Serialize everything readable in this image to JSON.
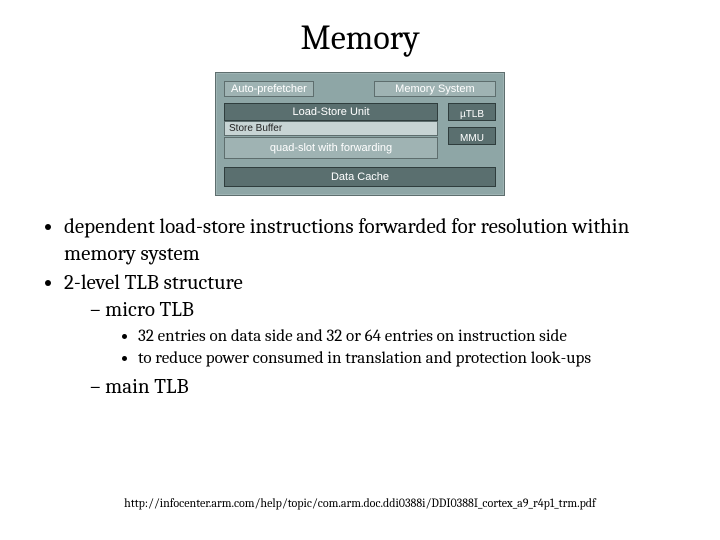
{
  "title": "Memory",
  "diagram": {
    "auto_prefetcher": "Auto-prefetcher",
    "memory_system": "Memory System",
    "load_store_unit": "Load-Store Unit",
    "store_buffer": "Store Buffer",
    "quad_slot": "quad-slot with forwarding",
    "utlb": "µTLB",
    "mmu": "MMU",
    "data_cache": "Data Cache"
  },
  "bullets": {
    "b1": "dependent load-store instructions forwarded for resolution within memory system",
    "b2": "2-level TLB structure",
    "b2a": "micro TLB",
    "b2a1": "32 entries on data side and 32 or 64 entries on instruction side",
    "b2a2": "to reduce power consumed in translation and protection look-ups",
    "b2b": "main TLB"
  },
  "footer": "http://infocenter.arm.com/help/topic/com.arm.doc.ddi0388i/DDI0388I_cortex_a9_r4p1_trm.pdf"
}
